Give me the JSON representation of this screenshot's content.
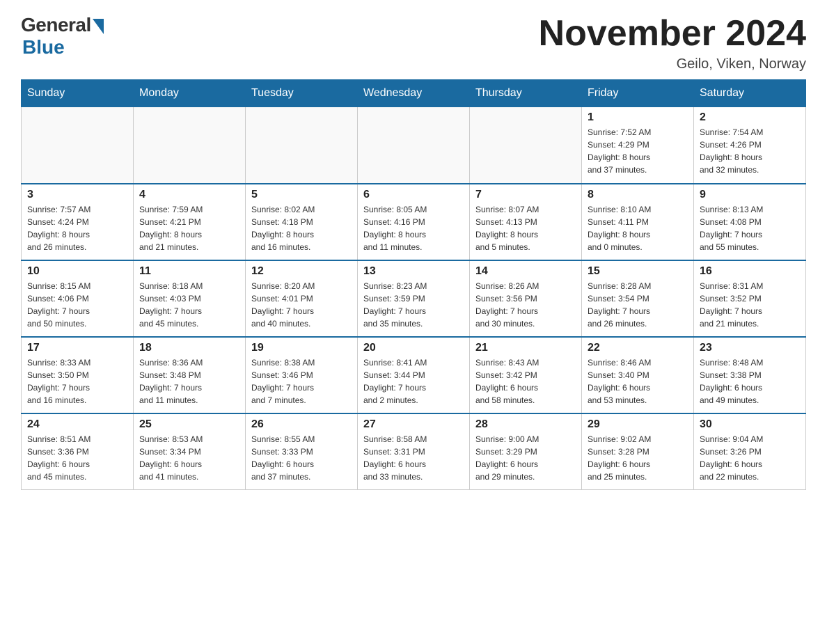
{
  "header": {
    "logo_general": "General",
    "logo_blue": "Blue",
    "title": "November 2024",
    "location": "Geilo, Viken, Norway"
  },
  "weekdays": [
    "Sunday",
    "Monday",
    "Tuesday",
    "Wednesday",
    "Thursday",
    "Friday",
    "Saturday"
  ],
  "weeks": [
    [
      {
        "day": "",
        "info": ""
      },
      {
        "day": "",
        "info": ""
      },
      {
        "day": "",
        "info": ""
      },
      {
        "day": "",
        "info": ""
      },
      {
        "day": "",
        "info": ""
      },
      {
        "day": "1",
        "info": "Sunrise: 7:52 AM\nSunset: 4:29 PM\nDaylight: 8 hours\nand 37 minutes."
      },
      {
        "day": "2",
        "info": "Sunrise: 7:54 AM\nSunset: 4:26 PM\nDaylight: 8 hours\nand 32 minutes."
      }
    ],
    [
      {
        "day": "3",
        "info": "Sunrise: 7:57 AM\nSunset: 4:24 PM\nDaylight: 8 hours\nand 26 minutes."
      },
      {
        "day": "4",
        "info": "Sunrise: 7:59 AM\nSunset: 4:21 PM\nDaylight: 8 hours\nand 21 minutes."
      },
      {
        "day": "5",
        "info": "Sunrise: 8:02 AM\nSunset: 4:18 PM\nDaylight: 8 hours\nand 16 minutes."
      },
      {
        "day": "6",
        "info": "Sunrise: 8:05 AM\nSunset: 4:16 PM\nDaylight: 8 hours\nand 11 minutes."
      },
      {
        "day": "7",
        "info": "Sunrise: 8:07 AM\nSunset: 4:13 PM\nDaylight: 8 hours\nand 5 minutes."
      },
      {
        "day": "8",
        "info": "Sunrise: 8:10 AM\nSunset: 4:11 PM\nDaylight: 8 hours\nand 0 minutes."
      },
      {
        "day": "9",
        "info": "Sunrise: 8:13 AM\nSunset: 4:08 PM\nDaylight: 7 hours\nand 55 minutes."
      }
    ],
    [
      {
        "day": "10",
        "info": "Sunrise: 8:15 AM\nSunset: 4:06 PM\nDaylight: 7 hours\nand 50 minutes."
      },
      {
        "day": "11",
        "info": "Sunrise: 8:18 AM\nSunset: 4:03 PM\nDaylight: 7 hours\nand 45 minutes."
      },
      {
        "day": "12",
        "info": "Sunrise: 8:20 AM\nSunset: 4:01 PM\nDaylight: 7 hours\nand 40 minutes."
      },
      {
        "day": "13",
        "info": "Sunrise: 8:23 AM\nSunset: 3:59 PM\nDaylight: 7 hours\nand 35 minutes."
      },
      {
        "day": "14",
        "info": "Sunrise: 8:26 AM\nSunset: 3:56 PM\nDaylight: 7 hours\nand 30 minutes."
      },
      {
        "day": "15",
        "info": "Sunrise: 8:28 AM\nSunset: 3:54 PM\nDaylight: 7 hours\nand 26 minutes."
      },
      {
        "day": "16",
        "info": "Sunrise: 8:31 AM\nSunset: 3:52 PM\nDaylight: 7 hours\nand 21 minutes."
      }
    ],
    [
      {
        "day": "17",
        "info": "Sunrise: 8:33 AM\nSunset: 3:50 PM\nDaylight: 7 hours\nand 16 minutes."
      },
      {
        "day": "18",
        "info": "Sunrise: 8:36 AM\nSunset: 3:48 PM\nDaylight: 7 hours\nand 11 minutes."
      },
      {
        "day": "19",
        "info": "Sunrise: 8:38 AM\nSunset: 3:46 PM\nDaylight: 7 hours\nand 7 minutes."
      },
      {
        "day": "20",
        "info": "Sunrise: 8:41 AM\nSunset: 3:44 PM\nDaylight: 7 hours\nand 2 minutes."
      },
      {
        "day": "21",
        "info": "Sunrise: 8:43 AM\nSunset: 3:42 PM\nDaylight: 6 hours\nand 58 minutes."
      },
      {
        "day": "22",
        "info": "Sunrise: 8:46 AM\nSunset: 3:40 PM\nDaylight: 6 hours\nand 53 minutes."
      },
      {
        "day": "23",
        "info": "Sunrise: 8:48 AM\nSunset: 3:38 PM\nDaylight: 6 hours\nand 49 minutes."
      }
    ],
    [
      {
        "day": "24",
        "info": "Sunrise: 8:51 AM\nSunset: 3:36 PM\nDaylight: 6 hours\nand 45 minutes."
      },
      {
        "day": "25",
        "info": "Sunrise: 8:53 AM\nSunset: 3:34 PM\nDaylight: 6 hours\nand 41 minutes."
      },
      {
        "day": "26",
        "info": "Sunrise: 8:55 AM\nSunset: 3:33 PM\nDaylight: 6 hours\nand 37 minutes."
      },
      {
        "day": "27",
        "info": "Sunrise: 8:58 AM\nSunset: 3:31 PM\nDaylight: 6 hours\nand 33 minutes."
      },
      {
        "day": "28",
        "info": "Sunrise: 9:00 AM\nSunset: 3:29 PM\nDaylight: 6 hours\nand 29 minutes."
      },
      {
        "day": "29",
        "info": "Sunrise: 9:02 AM\nSunset: 3:28 PM\nDaylight: 6 hours\nand 25 minutes."
      },
      {
        "day": "30",
        "info": "Sunrise: 9:04 AM\nSunset: 3:26 PM\nDaylight: 6 hours\nand 22 minutes."
      }
    ]
  ]
}
